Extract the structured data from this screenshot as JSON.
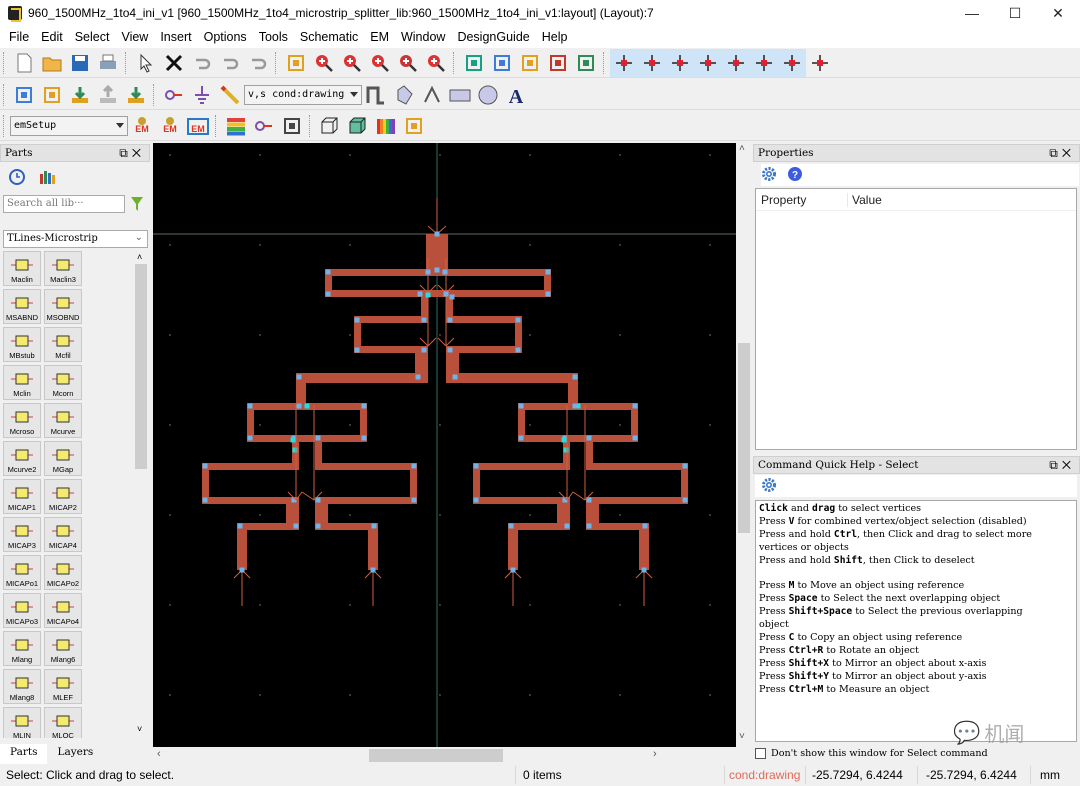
{
  "window": {
    "title": "960_1500MHz_1to4_ini_v1 [960_1500MHz_1to4_microstrip_splitter_lib:960_1500MHz_1to4_ini_v1:layout] (Layout):7",
    "minimize": "—",
    "maximize": "☐",
    "close": "✕"
  },
  "menu": [
    "File",
    "Edit",
    "Select",
    "View",
    "Insert",
    "Options",
    "Tools",
    "Schematic",
    "EM",
    "Window",
    "DesignGuide",
    "Help"
  ],
  "toolbar1": {
    "icons": [
      "new-file-icon",
      "open-folder-icon",
      "save-icon",
      "print-icon",
      "select-arrow-icon",
      "delete-icon",
      "undo-icon",
      "redo-icon",
      "repeat-icon",
      "pan-icon",
      "zoom-area-icon",
      "zoom-in-icon",
      "zoom-in-2-icon",
      "zoom-out-2-icon",
      "zoom-fit-icon",
      "align-icon",
      "distribute-icon",
      "move-to-layer-icon",
      "swap-icon",
      "flip-icon"
    ],
    "snap_icons": [
      "snap-enable-icon",
      "snap-pin-icon",
      "snap-vertex-icon",
      "snap-midpoint-icon",
      "snap-edge-icon",
      "snap-center-icon",
      "snap-intersection-icon",
      "snap-grid-icon"
    ]
  },
  "toolbar2": {
    "icons": [
      "simulate-icon",
      "tune-icon",
      "push-in-icon",
      "pop-out-icon",
      "generate-layout-icon",
      "port-icon",
      "ground-icon",
      "trace-icon"
    ],
    "layer_select": "v,s cond:drawing",
    "shape_icons": [
      "polyline-icon",
      "polygon-icon",
      "path-icon",
      "rectangle-icon",
      "circle-icon",
      "text-icon"
    ]
  },
  "toolbar3": {
    "em_setup_select": "emSetup",
    "icons": [
      "em-simulate-icon",
      "em-stop-icon",
      "em-icon",
      "layer-stack-icon",
      "port-editor-icon",
      "component-icon",
      "3d-wireframe-icon",
      "3d-view-icon",
      "substrate-icon",
      "mesh-icon"
    ],
    "em_label": "EM"
  },
  "parts_panel": {
    "title": "Parts",
    "search_placeholder": "Search all lib···",
    "library": "TLines-Microstrip",
    "items": [
      "Maclin",
      "Maclin3",
      "MSABND",
      "MSOBND",
      "MBstub",
      "Mcfil",
      "Mclin",
      "Mcorn",
      "Mcroso",
      "Mcurve",
      "Mcurve2",
      "MGap",
      "MICAP1",
      "MICAP2",
      "MICAP3",
      "MICAP4",
      "MICAPo1",
      "MICAPo2",
      "MICAPo3",
      "MICAPo4",
      "Mlang",
      "Mlang6",
      "Mlang8",
      "MLEF",
      "MLIN",
      "MLOC"
    ],
    "tabs": [
      "Parts",
      "Layers"
    ],
    "active_tab": "Parts"
  },
  "properties_panel": {
    "title": "Properties",
    "columns": [
      "Property",
      "Value"
    ]
  },
  "quick_help": {
    "title": "Command Quick Help - Select",
    "lines": [
      [
        {
          "b": "Click"
        },
        {
          "t": " and "
        },
        {
          "b": "drag"
        },
        {
          "t": " to select vertices"
        }
      ],
      [
        {
          "t": "Press "
        },
        {
          "b": "V"
        },
        {
          "t": " for combined vertex/object selection (disabled)"
        }
      ],
      [
        {
          "t": "Press and hold "
        },
        {
          "b": "Ctrl"
        },
        {
          "t": ", then Click and drag to select more"
        }
      ],
      [
        {
          "t": "vertices or objects"
        }
      ],
      [
        {
          "t": "Press and hold "
        },
        {
          "b": "Shift"
        },
        {
          "t": ", then Click to deselect"
        }
      ],
      [
        {
          "t": ""
        }
      ],
      [
        {
          "t": "Press "
        },
        {
          "b": "M"
        },
        {
          "t": " to Move an object using reference"
        }
      ],
      [
        {
          "t": "Press "
        },
        {
          "b": "Space"
        },
        {
          "t": " to Select the next overlapping object"
        }
      ],
      [
        {
          "t": "Press "
        },
        {
          "b": "Shift+Space"
        },
        {
          "t": " to Select the previous overlapping"
        }
      ],
      [
        {
          "t": "object"
        }
      ],
      [
        {
          "t": "Press "
        },
        {
          "b": "C"
        },
        {
          "t": " to Copy an object using reference"
        }
      ],
      [
        {
          "t": "Press "
        },
        {
          "b": "Ctrl+R"
        },
        {
          "t": " to Rotate an object"
        }
      ],
      [
        {
          "t": "Press "
        },
        {
          "b": "Shift+X"
        },
        {
          "t": " to Mirror an object about x-axis"
        }
      ],
      [
        {
          "t": "Press "
        },
        {
          "b": "Shift+Y"
        },
        {
          "t": " to Mirror an object about y-axis"
        }
      ],
      [
        {
          "t": "Press "
        },
        {
          "b": "Ctrl+M"
        },
        {
          "t": " to Measure an object"
        }
      ]
    ],
    "dont_show": "Don't show this window for Select command",
    "dont_show_checked": false
  },
  "canvas": {
    "layer_color": "#b8503c",
    "vertex_color": "#6fb3ea",
    "selected_vertex_color": "#1de0e0",
    "background": "#000000"
  },
  "status": {
    "message": "Select: Click and drag to select.",
    "items": "0 items",
    "layer": "cond:drawing",
    "coord1": "-25.7294, 6.4244",
    "coord2": "-25.7294, 6.4244",
    "units": "mm"
  },
  "watermark": "机闻"
}
